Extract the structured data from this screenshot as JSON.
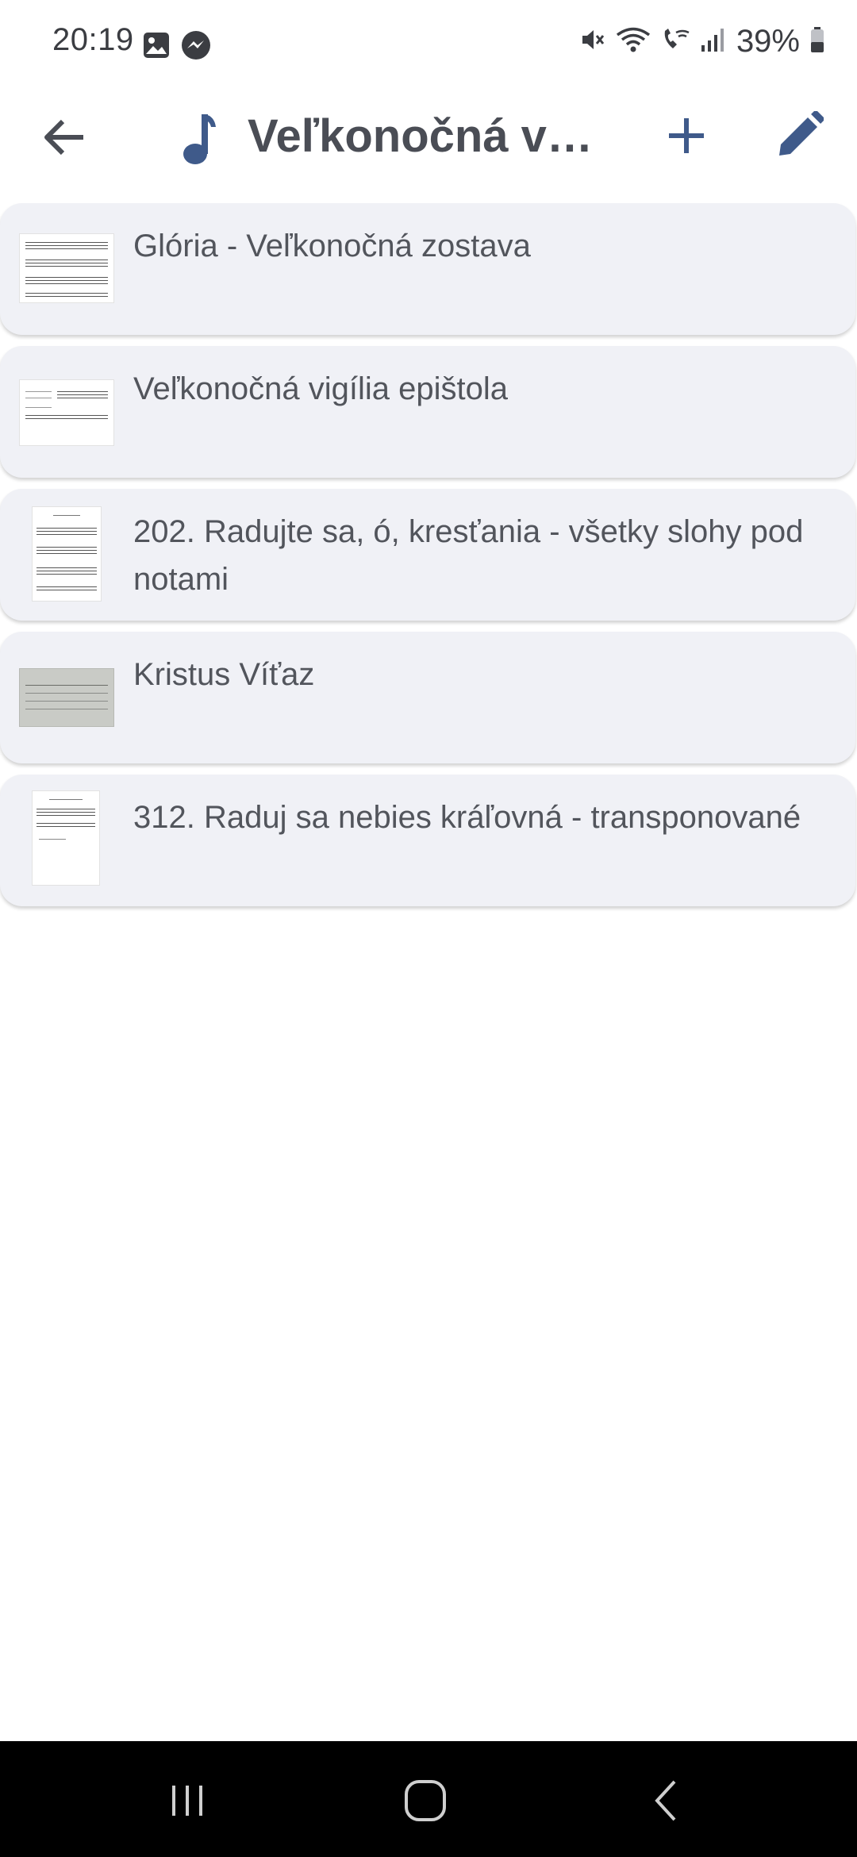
{
  "status_bar": {
    "time": "20:19",
    "battery_percent": "39%",
    "left_icons": [
      "gallery-icon",
      "messenger-icon"
    ],
    "right_icons": [
      "mute-icon",
      "wifi-icon",
      "wifi-calling-icon",
      "signal-icon",
      "battery-icon"
    ]
  },
  "app_bar": {
    "title": "Veľkonočná vi...",
    "accent_color": "#3f5a8a",
    "icons": [
      "back-arrow-icon",
      "music-note-icon",
      "plus-icon",
      "pencil-icon"
    ]
  },
  "items": [
    {
      "title": "Glória - Veľkonočná zostava"
    },
    {
      "title": "Veľkonočná vigília epištola"
    },
    {
      "title": "202. Radujte sa, ó, kresťania - všetky slohy pod notami"
    },
    {
      "title": "Kristus Víťaz"
    },
    {
      "title": "312. Raduj sa nebies kráľovná - transponované"
    }
  ],
  "nav_bar": {
    "icons": [
      "recents-icon",
      "home-icon",
      "back-icon"
    ]
  }
}
